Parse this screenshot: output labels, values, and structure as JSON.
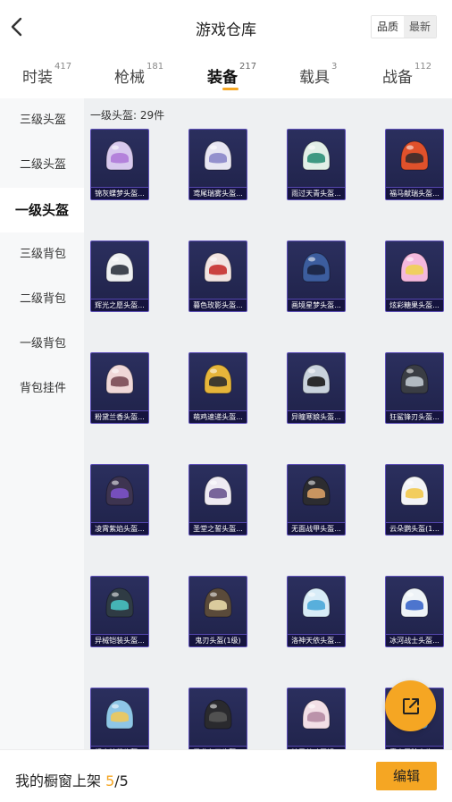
{
  "header": {
    "title": "游戏仓库",
    "back_icon": "chevron-left-icon",
    "sort": [
      "品质",
      "最新"
    ]
  },
  "tabs": [
    {
      "label": "时装",
      "count": "417"
    },
    {
      "label": "枪械",
      "count": "181"
    },
    {
      "label": "装备",
      "count": "217",
      "active": true
    },
    {
      "label": "载具",
      "count": "3"
    },
    {
      "label": "战备",
      "count": "112"
    }
  ],
  "sidebar": {
    "items": [
      "三级头盔",
      "二级头盔",
      "一级头盔",
      "三级背包",
      "二级背包",
      "一级背包",
      "背包挂件"
    ],
    "active_index": 2
  },
  "content": {
    "section_label": "一级头盔: 29件",
    "items": [
      {
        "name": "锦灰蝶梦头盔...",
        "color": "#d8c9ee",
        "visor": "#b07ad8"
      },
      {
        "name": "鸢尾瑞雾头盔...",
        "color": "#e8e6f2",
        "visor": "#8b86c9"
      },
      {
        "name": "雨过天青头盔...",
        "color": "#e2efe7",
        "visor": "#2e8f77"
      },
      {
        "name": "福马献瑞头盔...",
        "color": "#e0512b",
        "visor": "#3b2b2b"
      },
      {
        "name": "辉光之愿头盔...",
        "color": "#eef0f2",
        "visor": "#2e3440"
      },
      {
        "name": "暮色玫影头盔...",
        "color": "#f2e4e2",
        "visor": "#c72f2f"
      },
      {
        "name": "画境星梦头盔...",
        "color": "#3c5d9e",
        "visor": "#1b2440"
      },
      {
        "name": "炫彩糖果头盔...",
        "color": "#f4b8dd",
        "visor": "#f0d252"
      },
      {
        "name": "粉黛兰香头盔...",
        "color": "#f0d8d8",
        "visor": "#7a4b55"
      },
      {
        "name": "萌鸡速递头盔...",
        "color": "#e6b53a",
        "visor": "#2d2d2d"
      },
      {
        "name": "异瞳寒娘头盔...",
        "color": "#c9d3dd",
        "visor": "#1a1a1a"
      },
      {
        "name": "狂鲨锋刃头盔...",
        "color": "#3a3d44",
        "visor": "#bfc7cf"
      },
      {
        "name": "凌霄紫焰头盔...",
        "color": "#3d3450",
        "visor": "#7c52c9"
      },
      {
        "name": "圣堂之誓头盔...",
        "color": "#eeeaf2",
        "visor": "#6a5790"
      },
      {
        "name": "无面战甲头盔...",
        "color": "#2c2c30",
        "visor": "#d9a066"
      },
      {
        "name": "云朵鹦头盔(1...",
        "color": "#f3f4f6",
        "visor": "#f2c94c"
      },
      {
        "name": "异械铠装头盔...",
        "color": "#2f3b44",
        "visor": "#48c2c2"
      },
      {
        "name": "鬼刃头盔(1级)",
        "color": "#5a4a3a",
        "visor": "#e8d9a8"
      },
      {
        "name": "洛神天依头盔...",
        "color": "#d8ecf7",
        "visor": "#4aa8d8"
      },
      {
        "name": "冰河战士头盔...",
        "color": "#eef3f7",
        "visor": "#3b67c9"
      },
      {
        "name": "绿真涟花头盔...",
        "color": "#8ec6e6",
        "visor": "#f0c85a"
      },
      {
        "name": "墨龙九天头盔...",
        "color": "#2a2a2e",
        "visor": "#555"
      },
      {
        "name": "精灵梦叶罗娟...",
        "color": "#f2dfe6",
        "visor": "#b58ba3"
      },
      {
        "name": "青春冒险家头...",
        "color": "#5aa0e0",
        "visor": "#f0f0f0"
      }
    ]
  },
  "fab": {
    "icon": "share-external-icon"
  },
  "footer": {
    "prefix": "我的橱窗上架 ",
    "current": "5",
    "sep": "/",
    "total": "5",
    "edit_label": "编辑"
  },
  "colors": {
    "accent": "#f5a623",
    "card_border": "#5d4fb8",
    "card_bg": "#1f2249"
  }
}
